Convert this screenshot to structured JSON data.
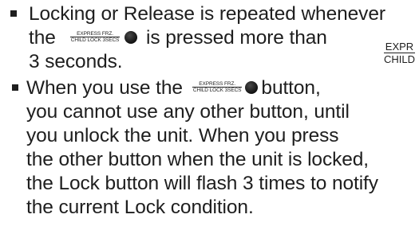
{
  "button_label": {
    "top": "EXPRESS FRZ.",
    "bottom": "CHILD LOCK 3SECS"
  },
  "side_label": {
    "top": "EXPR",
    "bottom": "CHILD"
  },
  "bullet1": {
    "line1": "Locking or Release is repeated whenever",
    "line2_pre": "the",
    "line2_post": "is pressed more than",
    "line3": "3 seconds."
  },
  "bullet2": {
    "line1_pre": "When you use the",
    "line1_post": "button,",
    "line2": "you cannot use any other button, until",
    "line3": "you unlock the unit. When you press",
    "line4": "the other button when the unit is locked,",
    "line5": "the Lock button will  flash 3 times to notify",
    "line6": "the current Lock condition."
  }
}
